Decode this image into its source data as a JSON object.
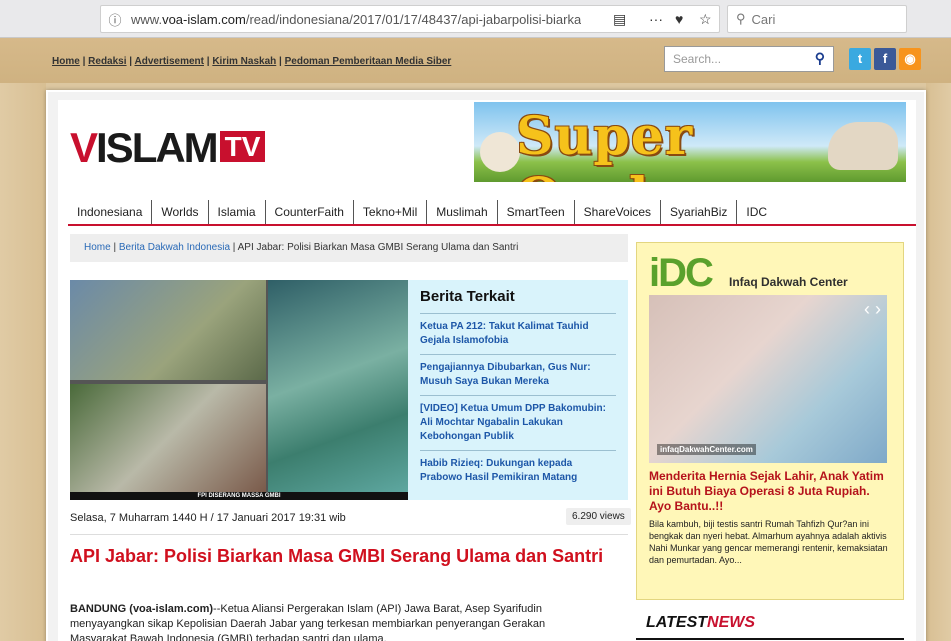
{
  "browser": {
    "url_prefix": "www.",
    "url_domain": "voa-islam.com",
    "url_path": "/read/indonesiana/2017/01/17/48437/api-jabarpolisi-biarkan-",
    "search_placeholder": "Cari"
  },
  "toplinks": [
    "Home",
    "Redaksi",
    "Advertisement",
    "Kirim Naskah",
    "Pedoman Pemberitaan Media Siber"
  ],
  "site_search_placeholder": "Search...",
  "logo": {
    "a": "V",
    "b": "ISLAM",
    "tv": "TV"
  },
  "banner_text": "Super Qurban",
  "nav": [
    "Indonesiana",
    "Worlds",
    "Islamia",
    "CounterFaith",
    "Tekno+Mil",
    "Muslimah",
    "SmartTeen",
    "ShareVoices",
    "SyariahBiz",
    "IDC"
  ],
  "breadcrumb": {
    "home": "Home",
    "section": "Berita Dakwah Indonesia",
    "current": "API Jabar: Polisi Biarkan Masa GMBI Serang Ulama dan Santri"
  },
  "photo_caption": "FPI DISERANG MASSA GMBI",
  "related": {
    "title": "Berita Terkait",
    "items": [
      "Ketua PA 212: Takut Kalimat Tauhid Gejala Islamofobia",
      "Pengajiannya Dibubarkan, Gus Nur: Musuh Saya Bukan Mereka",
      "[VIDEO] Ketua Umum DPP Bakomubin: Ali Mochtar Ngabalin Lakukan Kebohongan Publik",
      "Habib Rizieq: Dukungan kepada Prabowo Hasil Pemikiran Matang"
    ]
  },
  "article": {
    "date": "Selasa, 7 Muharram 1440 H / 17 Januari 2017 19:31 wib",
    "views": "6.290 views",
    "title": "API Jabar: Polisi Biarkan Masa GMBI Serang Ulama dan Santri",
    "lead_bold": "BANDUNG (voa-islam.com)",
    "lead_text": "--Ketua Aliansi Pergerakan Islam (API) Jawa Barat, Asep Syarifudin menyayangkan sikap Kepolisian Daerah Jabar yang terkesan membiarkan penyerangan Gerakan Masyarakat Bawah Indonesia (GMBI) terhadap santri dan ulama."
  },
  "idc": {
    "logo": "iDC",
    "name": "Infaq Dakwah Center",
    "watermark": "infaqDakwahCenter.com",
    "headline": "Menderita Hernia Sejak Lahir, Anak Yatim ini Butuh Biaya Operasi 8 Juta Rupiah. Ayo Bantu..!!",
    "desc": "Bila kambuh, biji testis santri Rumah Tahfizh Qur?an ini bengkak dan nyeri hebat. Almarhum ayahnya adalah aktivis Nahi Munkar yang gencar memerangi rentenir, kemaksiatan dan pemurtadan. Ayo..."
  },
  "latest": {
    "a": "LATEST",
    "b": "NEWS"
  }
}
